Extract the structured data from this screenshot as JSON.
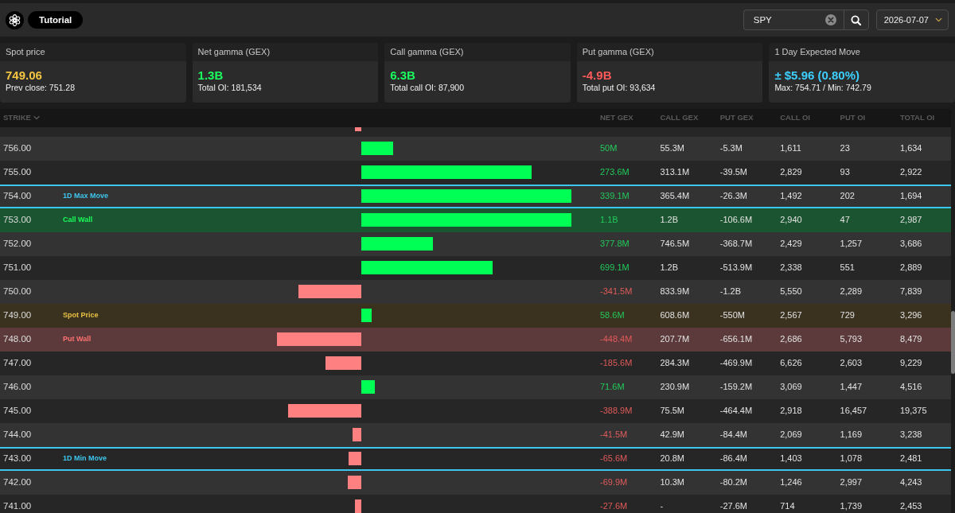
{
  "toolbar": {
    "tutorial_button": "Tutorial",
    "search": {
      "value": "SPY"
    },
    "date": "2026-07-07"
  },
  "cards": [
    {
      "title": "Spot price",
      "value": "749.06",
      "color": "#f5c542",
      "detail": "Prev close: 751.28"
    },
    {
      "title": "Net gamma (GEX)",
      "value": "1.3B",
      "color": "#1aff5e",
      "detail": "Total OI: 181,534"
    },
    {
      "title": "Call gamma (GEX)",
      "value": "6.3B",
      "color": "#1aff5e",
      "detail": "Total call OI: 87,900"
    },
    {
      "title": "Put gamma (GEX)",
      "value": "-4.9B",
      "color": "#ff5a5a",
      "detail": "Total put OI: 93,634"
    },
    {
      "title": "1 Day Expected Move",
      "value": "± $5.96 (0.80%)",
      "color": "#3dcfff",
      "detail": "Max: 754.71 / Min: 742.79"
    }
  ],
  "table": {
    "columns": [
      {
        "label": "STRIKE",
        "sorted": true
      },
      {
        "label": "NET GEX",
        "sorted": false
      },
      {
        "label": "CALL GEX",
        "sorted": false
      },
      {
        "label": "PUT GEX",
        "sorted": false
      },
      {
        "label": "CALL OI",
        "sorted": false
      },
      {
        "label": "PUT OI",
        "sorted": false
      },
      {
        "label": "TOTAL OI",
        "sorted": false
      }
    ],
    "rows": [
      {
        "negative": true
      },
      {
        "strike": "756.00",
        "negative": false,
        "net_gex": "50M",
        "call_gex": "55.3M",
        "put_gex": "-5.3M",
        "call_oi": "1,611",
        "put_oi": "23",
        "total_oi": "1,634"
      },
      {
        "strike": "755.00",
        "negative": false,
        "net_gex": "273.6M",
        "call_gex": "313.1M",
        "put_gex": "-39.5M",
        "call_oi": "2,829",
        "put_oi": "93",
        "total_oi": "2,922"
      },
      {
        "strike": "754.00",
        "tag": {
          "kind": "max_move",
          "text": "1D Max Move"
        },
        "negative": false,
        "net_gex": "339.1M",
        "call_gex": "365.4M",
        "put_gex": "-26.3M",
        "call_oi": "1,492",
        "put_oi": "202",
        "total_oi": "1,694"
      },
      {
        "strike": "753.00",
        "tag": {
          "kind": "call_wall",
          "text": "Call Wall"
        },
        "negative": false,
        "net_gex": "1.1B",
        "call_gex": "1.2B",
        "put_gex": "-106.6M",
        "call_oi": "2,940",
        "put_oi": "47",
        "total_oi": "2,987"
      },
      {
        "strike": "752.00",
        "negative": false,
        "net_gex": "377.8M",
        "call_gex": "746.5M",
        "put_gex": "-368.7M",
        "call_oi": "2,429",
        "put_oi": "1,257",
        "total_oi": "3,686"
      },
      {
        "strike": "751.00",
        "negative": false,
        "net_gex": "699.1M",
        "call_gex": "1.2B",
        "put_gex": "-513.9M",
        "call_oi": "2,338",
        "put_oi": "551",
        "total_oi": "2,889"
      },
      {
        "strike": "750.00",
        "negative": true,
        "net_gex": "-341.5M",
        "call_gex": "833.9M",
        "put_gex": "-1.2B",
        "call_oi": "5,550",
        "put_oi": "2,289",
        "total_oi": "7,839"
      },
      {
        "strike": "749.00",
        "tag": {
          "kind": "spot_price",
          "text": "Spot Price"
        },
        "negative": false,
        "net_gex": "58.6M",
        "call_gex": "608.6M",
        "put_gex": "-550M",
        "call_oi": "2,567",
        "put_oi": "729",
        "total_oi": "3,296"
      },
      {
        "strike": "748.00",
        "tag": {
          "kind": "put_wall",
          "text": "Put Wall"
        },
        "negative": true,
        "net_gex": "-448.4M",
        "call_gex": "207.7M",
        "put_gex": "-656.1M",
        "call_oi": "2,686",
        "put_oi": "5,793",
        "total_oi": "8,479"
      },
      {
        "strike": "747.00",
        "negative": true,
        "net_gex": "-185.6M",
        "call_gex": "284.3M",
        "put_gex": "-469.9M",
        "call_oi": "6,626",
        "put_oi": "2,603",
        "total_oi": "9,229"
      },
      {
        "strike": "746.00",
        "negative": false,
        "net_gex": "71.6M",
        "call_gex": "230.9M",
        "put_gex": "-159.2M",
        "call_oi": "3,069",
        "put_oi": "1,447",
        "total_oi": "4,516"
      },
      {
        "strike": "745.00",
        "negative": true,
        "net_gex": "-388.9M",
        "call_gex": "75.5M",
        "put_gex": "-464.4M",
        "call_oi": "2,918",
        "put_oi": "16,457",
        "total_oi": "19,375"
      },
      {
        "strike": "744.00",
        "negative": true,
        "net_gex": "-41.5M",
        "call_gex": "42.9M",
        "put_gex": "-84.4M",
        "call_oi": "2,069",
        "put_oi": "1,169",
        "total_oi": "3,238"
      },
      {
        "strike": "743.00",
        "tag": {
          "kind": "min_move",
          "text": "1D Min Move"
        },
        "negative": true,
        "net_gex": "-65.6M",
        "call_gex": "20.8M",
        "put_gex": "-86.4M",
        "call_oi": "1,403",
        "put_oi": "1,078",
        "total_oi": "2,481"
      },
      {
        "strike": "742.00",
        "negative": true,
        "net_gex": "-69.9M",
        "call_gex": "10.3M",
        "put_gex": "-80.2M",
        "call_oi": "1,246",
        "put_oi": "2,997",
        "total_oi": "4,243"
      },
      {
        "strike": "741.00",
        "negative": true,
        "net_gex": "-27.6M",
        "call_gex": "-",
        "put_gex": "-27.6M",
        "call_oi": "714",
        "put_oi": "1,739",
        "total_oi": "2,453"
      }
    ]
  }
}
